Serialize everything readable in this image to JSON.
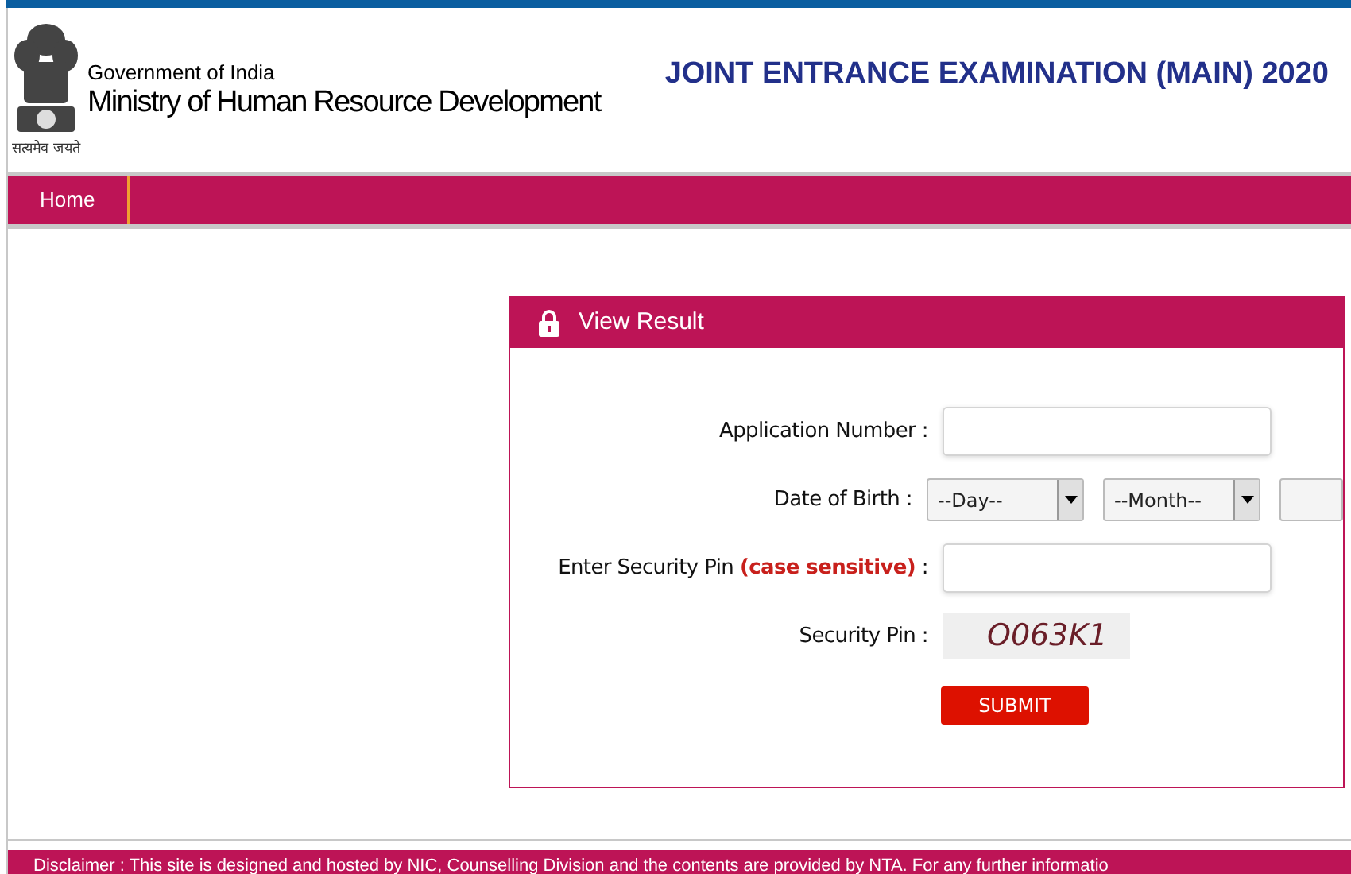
{
  "header": {
    "org_line_1": "Government of India",
    "org_line_2": "Ministry of Human Resource Development",
    "motto": "सत्यमेव जयते",
    "title": "JOINT ENTRANCE EXAMINATION (MAIN) 2020"
  },
  "nav": {
    "items": [
      {
        "label": "Home",
        "selected": false
      }
    ]
  },
  "card": {
    "title": "View Result",
    "fields": [
      {
        "kind": "text",
        "label": "Application Number :"
      },
      {
        "kind": "selects",
        "label": "Date of Birth :",
        "selects": [
          "--Day--",
          "--Month--"
        ]
      },
      {
        "kind": "text",
        "label": "Enter Security Pin **(case sensitive)** :"
      },
      {
        "kind": "captcha",
        "label": "Security Pin :",
        "code": "O063K1"
      }
    ],
    "button": "SUBMIT"
  },
  "footer": {
    "text": "Disclaimer : This site is designed and hosted by NIC, Counselling Division and the contents are provided by NTA. For any further informatio"
  }
}
